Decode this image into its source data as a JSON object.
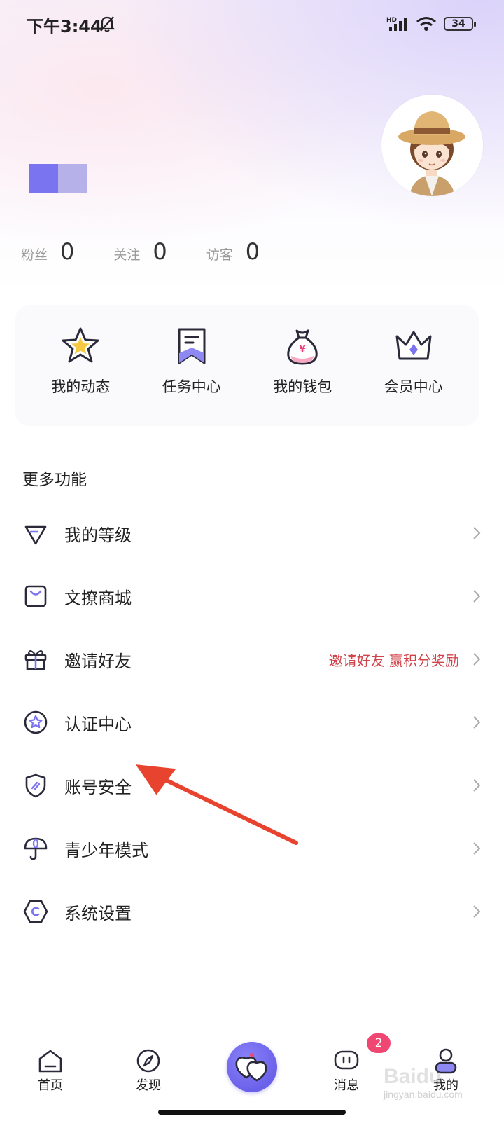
{
  "status_bar": {
    "time": "下午3:44",
    "network_label": "HD",
    "battery": "34"
  },
  "profile": {
    "stats": [
      {
        "label": "粉丝",
        "value": "0"
      },
      {
        "label": "关注",
        "value": "0"
      },
      {
        "label": "访客",
        "value": "0"
      }
    ]
  },
  "shortcuts": [
    {
      "label": "我的动态",
      "icon": "star-icon"
    },
    {
      "label": "任务中心",
      "icon": "bookmark-icon"
    },
    {
      "label": "我的钱包",
      "icon": "money-bag-icon"
    },
    {
      "label": "会员中心",
      "icon": "crown-icon"
    }
  ],
  "more_section": {
    "title": "更多功能",
    "items": [
      {
        "label": "我的等级",
        "icon": "diamond-icon",
        "extra": ""
      },
      {
        "label": "文撩商城",
        "icon": "shopping-bag-icon",
        "extra": ""
      },
      {
        "label": "邀请好友",
        "icon": "gift-icon",
        "extra": "邀请好友 赢积分奖励"
      },
      {
        "label": "认证中心",
        "icon": "badge-star-icon",
        "extra": ""
      },
      {
        "label": "账号安全",
        "icon": "shield-icon",
        "extra": ""
      },
      {
        "label": "青少年模式",
        "icon": "umbrella-icon",
        "extra": ""
      },
      {
        "label": "系统设置",
        "icon": "settings-hexagon-icon",
        "extra": ""
      }
    ]
  },
  "tab_bar": {
    "tabs": [
      {
        "label": "首页",
        "icon": "home-icon"
      },
      {
        "label": "发现",
        "icon": "compass-icon"
      },
      {
        "label": "消息",
        "icon": "message-icon"
      },
      {
        "label": "我的",
        "icon": "profile-icon"
      }
    ],
    "message_badge": "2"
  },
  "watermark": {
    "line1": "Baidu",
    "line2": "jingyan.baidu.com"
  },
  "colors": {
    "accent": "#6a61ea",
    "accent_light": "#b6b1e8",
    "highlight_text": "#d1434a",
    "badge": "#f04672",
    "annotation_arrow": "#e8432f"
  }
}
